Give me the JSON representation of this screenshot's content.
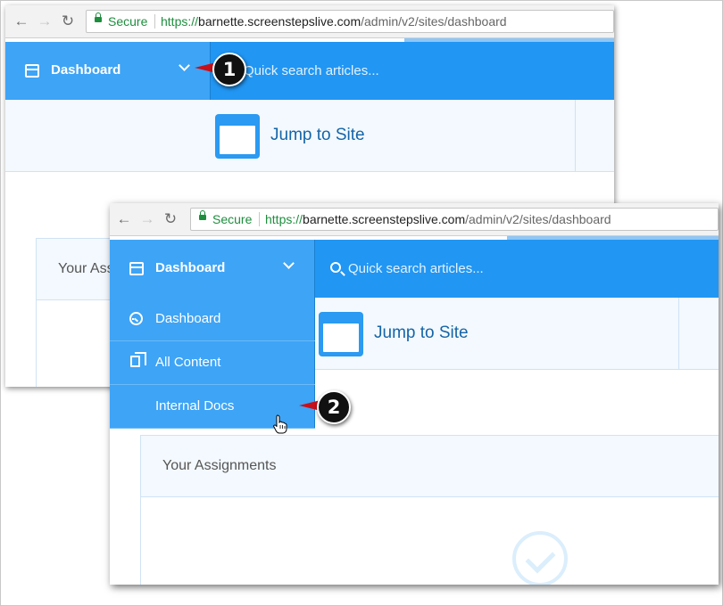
{
  "browser": {
    "back_icon": "arrow-left-icon",
    "forward_icon": "arrow-right-icon",
    "reload_icon": "reload-icon",
    "secure_label": "Secure",
    "url_scheme": "https://",
    "url_host": "barnette.screenstepslive.com",
    "url_path": "/admin/v2/sites/dashboard"
  },
  "header": {
    "dashboard_label": "Dashboard",
    "search_placeholder": "Quick search articles..."
  },
  "jump": {
    "label": "Jump to Site"
  },
  "assignments": {
    "title_back": "Your Ass",
    "title": "Your Assignments"
  },
  "dropdown": {
    "items": [
      {
        "label": "Dashboard",
        "icon": "gauge-icon"
      },
      {
        "label": "All Content",
        "icon": "copy-icon"
      },
      {
        "label": "Internal Docs",
        "icon": ""
      }
    ]
  },
  "callouts": {
    "step1": "1",
    "step2": "2"
  },
  "colors": {
    "primary": "#2196f3",
    "button": "#3ea4f6",
    "secure_green": "#1e8e3e",
    "callout_red": "#c8101a"
  }
}
